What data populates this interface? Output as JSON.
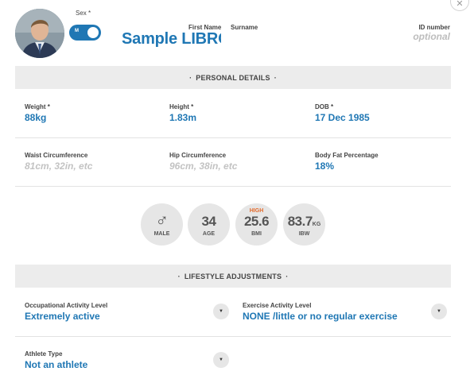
{
  "header": {
    "close_icon": "close-icon",
    "sex_label": "Sex *",
    "sex_toggle_value": "M",
    "first_name_label": "First Name",
    "surname_label": "Surname",
    "name_value": "Sample LIBRO",
    "id_label": "ID number",
    "id_placeholder": "optional"
  },
  "personal": {
    "title": "PERSONAL DETAILS",
    "fields": [
      {
        "label": "Weight *",
        "value": "88kg"
      },
      {
        "label": "Height *",
        "value": "1.83m"
      },
      {
        "label": "DOB *",
        "value": "17 Dec 1985"
      },
      {
        "label": "Waist Circumference",
        "placeholder": "81cm, 32in, etc"
      },
      {
        "label": "Hip Circumference",
        "placeholder": "96cm, 38in, etc"
      },
      {
        "label": "Body Fat Percentage",
        "value": "18%"
      }
    ]
  },
  "stats": {
    "sex": {
      "icon": "male-symbol-icon",
      "glyph": "♂",
      "label": "MALE"
    },
    "age": {
      "value": "34",
      "label": "AGE"
    },
    "bmi": {
      "value": "25.6",
      "label": "BMI",
      "badge": "HIGH"
    },
    "ibw": {
      "value": "83.7",
      "unit": "KG",
      "label": "IBW"
    }
  },
  "lifestyle": {
    "title": "LIFESTYLE ADJUSTMENTS",
    "occupational": {
      "label": "Occupational Activity Level",
      "value": "Extremely active"
    },
    "exercise": {
      "label": "Exercise Activity Level",
      "value": "NONE /little or no regular exercise"
    },
    "athlete": {
      "label": "Athlete Type",
      "value": "Not an athlete"
    },
    "dropdown_icon": "triangle-down-icon"
  },
  "colors": {
    "accent": "#1f77b4",
    "high": "#e36b2c",
    "section_bg": "#ececec",
    "circle_bg": "#e6e6e6"
  }
}
